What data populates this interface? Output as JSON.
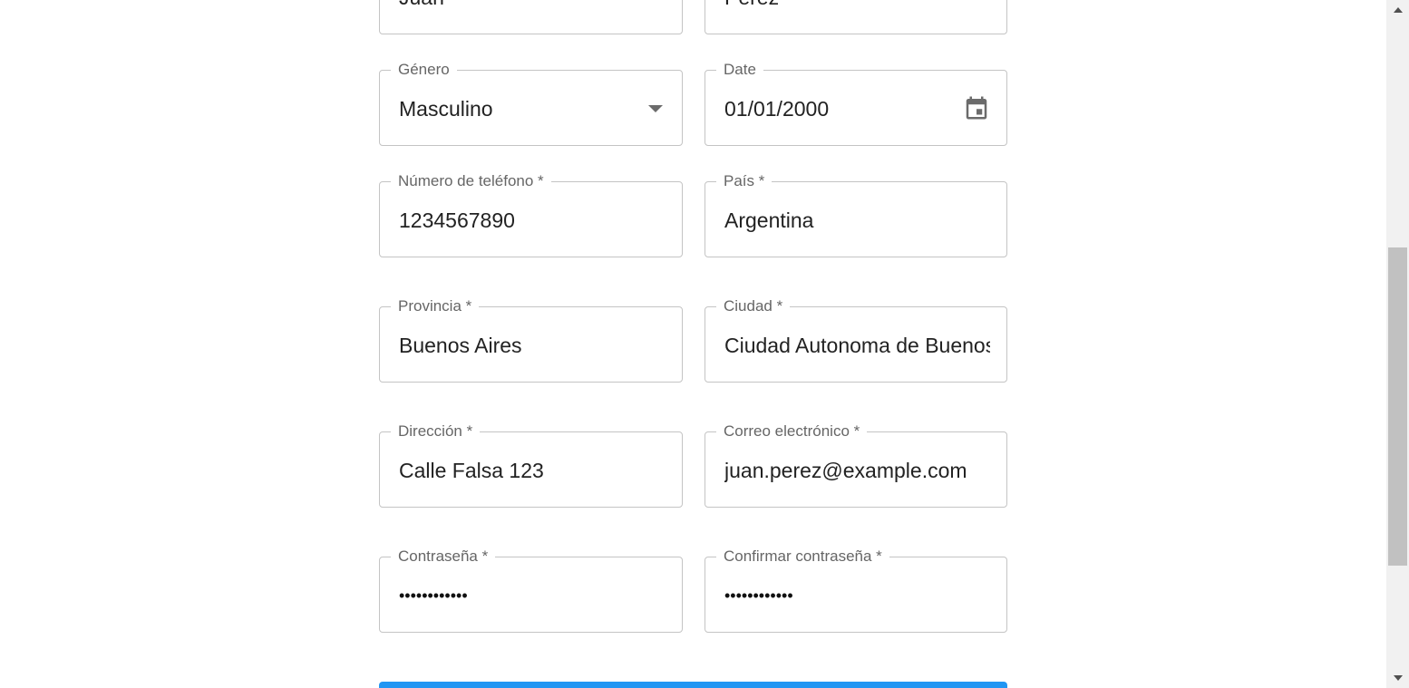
{
  "form": {
    "nombre": {
      "value": "Juan"
    },
    "apellido": {
      "value": "Perez"
    },
    "genero": {
      "label": "Género",
      "value": "Masculino",
      "icon": "chevron-down-icon"
    },
    "date": {
      "label": "Date",
      "value": "01/01/2000",
      "icon": "calendar-icon"
    },
    "telefono": {
      "label": "Número de teléfono *",
      "value": "1234567890"
    },
    "pais": {
      "label": "País *",
      "value": "Argentina"
    },
    "provincia": {
      "label": "Provincia *",
      "value": "Buenos Aires"
    },
    "ciudad": {
      "label": "Ciudad *",
      "value": "Ciudad Autonoma de Buenos Aires"
    },
    "direccion": {
      "label": "Dirección *",
      "value": "Calle Falsa 123"
    },
    "correo": {
      "label": "Correo electrónico *",
      "value": "juan.perez@example.com"
    },
    "contrasena": {
      "label": "Contraseña *",
      "value": "••••••••••••"
    },
    "confirmar": {
      "label": "Confirmar contraseña *",
      "value": "••••••••••••"
    }
  },
  "colors": {
    "border": "#c4c4c4",
    "label": "#666666",
    "text": "#222222",
    "primary": "#2196f3",
    "icon": "#6b6b6b"
  },
  "scrollbar": {
    "icons": {
      "up": "arrow-up-icon",
      "down": "arrow-down-icon"
    }
  }
}
